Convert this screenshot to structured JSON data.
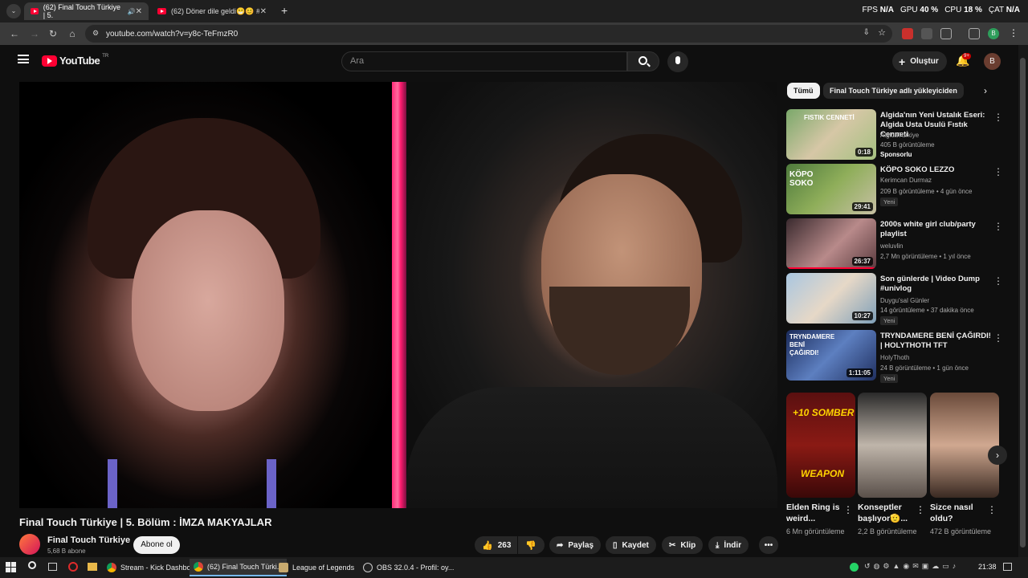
{
  "browser": {
    "tabs": [
      {
        "label": "(62) Final Touch Türkiye | 5.",
        "active": true
      },
      {
        "label": "(62) Döner dile geldi😁😊 #sh",
        "active": false
      }
    ],
    "new_tab": "+",
    "url": "youtube.com/watch?v=y8c-TeFmzR0",
    "perf": {
      "fps_label": "FPS",
      "fps_value": "N/A",
      "gpu_label": "GPU",
      "gpu_value": "40 %",
      "cpu_label": "CPU",
      "cpu_value": "18 %",
      "cat_label": "ÇAT",
      "cat_value": "N/A"
    },
    "profile_initial": "B"
  },
  "youtube": {
    "logo_text": "YouTube",
    "logo_sup": "TR",
    "search_placeholder": "Ara",
    "create_label": "Oluştur",
    "notif_count": "9+",
    "avatar_initial": "B"
  },
  "video": {
    "title": "Final Touch Türkiye | 5. Bölüm : İMZA MAKYAJLAR",
    "channel": "Final Touch Türkiye",
    "subscribers": "5,68 B abone",
    "subscribe_label": "Abone ol",
    "likes": "263",
    "share_label": "Paylaş",
    "save_label": "Kaydet",
    "clip_label": "Klip",
    "download_label": "İndir"
  },
  "sidebar": {
    "chips": [
      "Tümü",
      "Final Touch Türkiye adlı yükleyiciden"
    ],
    "recommendations": [
      {
        "title": "Algida'nın Yeni Ustalık Eseri: Algida Usta Usulü Fıstık Cenneti",
        "channel": "AlgidaTurkiye",
        "meta": "405 B görüntüleme",
        "extra": "Sponsorlu",
        "duration": "0:18",
        "thumb_text": "FISTIK CENNETİ"
      },
      {
        "title": "KÖPO SOKO LEZZO",
        "channel": "Kerimcan Durmaz",
        "meta": "209 B görüntüleme • 4 gün önce",
        "badge": "Yeni",
        "duration": "29:41",
        "thumb_text": "KÖPO SOKO"
      },
      {
        "title": "2000s white girl club/party playlist",
        "channel": "weluvlin",
        "meta": "2,7 Mn görüntüleme • 1 yıl önce",
        "duration": "26:37"
      },
      {
        "title": "Son günlerde | Video Dump #univlog",
        "channel": "Duygu'sal Günler",
        "meta": "14 görüntüleme • 37 dakika önce",
        "badge": "Yeni",
        "duration": "10:27"
      },
      {
        "title": "TRYNDAMERE BENİ ÇAĞIRDI! | HOLYTHOTH TFT",
        "channel": "HolyThoth",
        "meta": "24 B görüntüleme • 1 gün önce",
        "badge": "Yeni",
        "duration": "1:11:05",
        "thumb_text": "TRYNDAMERE BENİ ÇAĞIRDI!"
      }
    ],
    "shorts": [
      {
        "title": "Elden Ring is weird...",
        "views": "6 Mn görüntüleme",
        "thumb_top": "+10 SOMBER",
        "thumb_bottom": "WEAPON"
      },
      {
        "title": "Konseptler başlıyor🫡...",
        "views": "2,2 B görüntüleme"
      },
      {
        "title": "Sizce nasıl oldu?",
        "views": "472 B görüntüleme"
      }
    ]
  },
  "taskbar": {
    "items": [
      "Stream - Kick Dashbo...",
      "(62) Final Touch Türki...",
      "League of Legends",
      "OBS 32.0.4 - Profil: oy..."
    ],
    "clock": "21:38"
  },
  "colors": {
    "accent": "#ff0033",
    "background": "#0f0f0f",
    "surface": "#272727"
  }
}
